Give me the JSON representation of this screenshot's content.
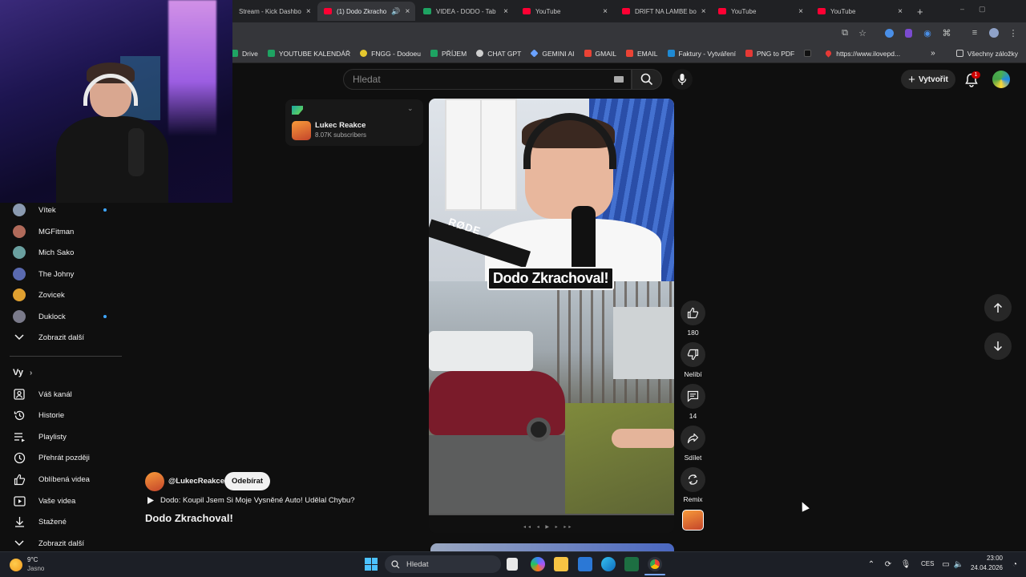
{
  "browser": {
    "tabs": [
      {
        "label": "Stream - Kick Dashbo",
        "favicon": "kick-icon",
        "active": false
      },
      {
        "label": "(1) Dodo Zkracho",
        "favicon": "youtube-icon",
        "active": true
      },
      {
        "label": "VIDEA - DODO - Tab",
        "favicon": "sheets-icon",
        "active": false
      },
      {
        "label": "YouTube",
        "favicon": "youtube-icon",
        "active": false
      },
      {
        "label": "DRIFT NA LAMBE bo",
        "favicon": "youtube-icon",
        "active": false
      },
      {
        "label": "YouTube",
        "favicon": "youtube-icon",
        "active": false
      },
      {
        "label": "YouTube",
        "favicon": "youtube-icon",
        "active": false
      }
    ],
    "new_tab": "+",
    "tab_close": "×",
    "bookmarks": [
      {
        "label": "Drive",
        "icon": "drive-icon",
        "color": "#1fa463"
      },
      {
        "label": "YOUTUBE KALENDÁŘ",
        "icon": "sheets-icon",
        "color": "#1ea362"
      },
      {
        "label": "FNGG - Dodoeu",
        "icon": "fngg-icon",
        "color": "#e4c72e"
      },
      {
        "label": "PŘÍJEM",
        "icon": "sheets-icon",
        "color": "#1ea362"
      },
      {
        "label": "CHAT GPT",
        "icon": "chatgpt-icon",
        "color": "#cfcfcf"
      },
      {
        "label": "GEMINI AI",
        "icon": "gemini-icon",
        "color": "#6aa2ff"
      },
      {
        "label": "GMAIL",
        "icon": "gmail-icon",
        "color": "#ea4335"
      },
      {
        "label": "EMAIL",
        "icon": "email-icon",
        "color": "#ea4335"
      },
      {
        "label": "Faktury - Vytváření",
        "icon": "faktury-icon",
        "color": "#1f8ad3"
      },
      {
        "label": "PNG to PDF",
        "icon": "pdf-icon",
        "color": "#e53935"
      },
      {
        "label": "",
        "icon": "bookmark-dark-icon",
        "color": "#111111"
      },
      {
        "label": "https://www.ilovepd...",
        "icon": "ilovepdf-icon",
        "color": "#e53935"
      }
    ],
    "bookmarks_overflow": "»",
    "all_bookmarks": "Všechny záložky"
  },
  "header": {
    "search_placeholder": "Hledat",
    "create_label": "Vytvořit",
    "notification_count": "1"
  },
  "sidebar": {
    "subscriptions": [
      {
        "name": "Vítek",
        "new": true,
        "color": "#8a9ab0"
      },
      {
        "name": "MGFitman",
        "new": false,
        "color": "#b06a5a"
      },
      {
        "name": "Mich Sako",
        "new": false,
        "color": "#6aa0a0"
      },
      {
        "name": "The Johny",
        "new": false,
        "color": "#5a6ab0"
      },
      {
        "name": "Zovicek",
        "new": false,
        "color": "#e0a030"
      },
      {
        "name": "Duklock",
        "new": true,
        "color": "#7a7a8a"
      }
    ],
    "show_more_subs": "Zobrazit další",
    "you_heading": "Vy",
    "you_items": [
      {
        "label": "Váš kanál",
        "icon": "channel-icon"
      },
      {
        "label": "Historie",
        "icon": "history-icon"
      },
      {
        "label": "Playlisty",
        "icon": "playlists-icon"
      },
      {
        "label": "Přehrát později",
        "icon": "watch-later-icon"
      },
      {
        "label": "Oblíbená videa",
        "icon": "liked-icon"
      },
      {
        "label": "Vaše videa",
        "icon": "your-videos-icon"
      },
      {
        "label": "Stažené",
        "icon": "downloads-icon"
      },
      {
        "label": "Zobrazit další",
        "icon": "chevron-down-icon"
      }
    ]
  },
  "channel_card": {
    "name": "Lukec Reakce",
    "subscribers": "8.07K subscribers"
  },
  "short": {
    "caption": "Dodo Zkrachoval!",
    "mic_brand": "RØDE",
    "progress": 0.0,
    "uploader": "@LukecReakce",
    "subscribe_label": "Odebírat",
    "playlist": "Dodo: Koupil Jsem Si Moje Vysněné Auto! Udělal Chybu?",
    "title": "Dodo Zkrachoval!"
  },
  "actions": {
    "likes": "180",
    "dislike": "Nelíbí",
    "comments": "14",
    "share": "Sdílet",
    "remix": "Remix"
  },
  "taskbar": {
    "weather_temp": "9°C",
    "weather_cond": "Jasno",
    "search_label": "Hledat",
    "language": "CES",
    "time": "23:00",
    "date": "24.04.2026"
  }
}
